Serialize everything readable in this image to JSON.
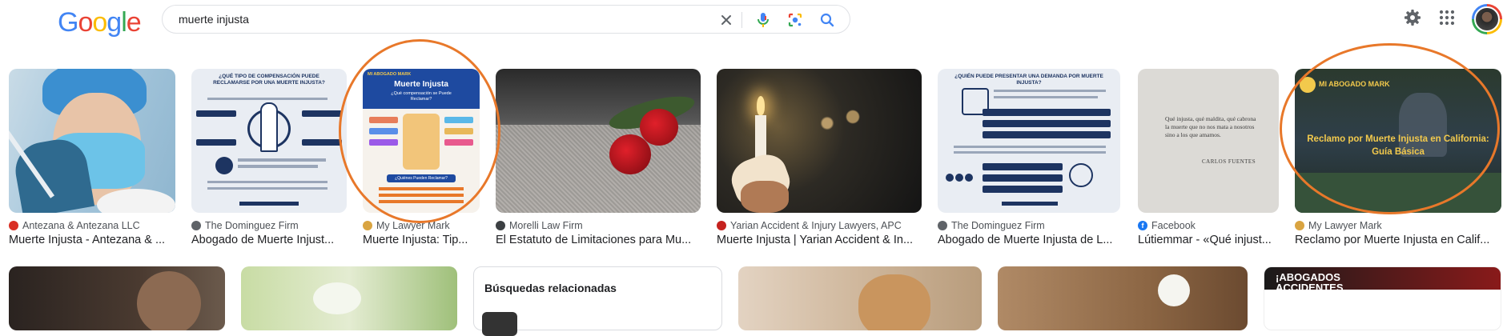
{
  "logo": {
    "letters": [
      {
        "ch": "G",
        "color": "#4285f4"
      },
      {
        "ch": "o",
        "color": "#ea4335"
      },
      {
        "ch": "o",
        "color": "#fbbc05"
      },
      {
        "ch": "g",
        "color": "#4285f4"
      },
      {
        "ch": "l",
        "color": "#34a853"
      },
      {
        "ch": "e",
        "color": "#ea4335"
      }
    ]
  },
  "search": {
    "query": "muerte injusta"
  },
  "icons": {
    "clear": "close-icon",
    "voice": "microphone-icon",
    "lens": "lens-icon",
    "search": "search-icon",
    "settings": "gear-icon",
    "apps": "apps-grid-icon"
  },
  "results": [
    {
      "source": "Antezana & Antezana LLC",
      "title": "Muerte Injusta - Antezana & ...",
      "fav_color": "#d93025"
    },
    {
      "source": "The Dominguez Firm",
      "title": "Abogado de Muerte Injust...",
      "fav_color": "#5f6368"
    },
    {
      "source": "My Lawyer Mark",
      "title": "Muerte Injusta: Tip...",
      "fav_color": "#d9a441"
    },
    {
      "source": "Morelli Law Firm",
      "title": "El Estatuto de Limitaciones para Mu...",
      "fav_color": "#3c4043"
    },
    {
      "source": "Yarian Accident & Injury Lawyers, APC",
      "title": "Muerte Injusta | Yarian Accident & In...",
      "fav_color": "#c5221f"
    },
    {
      "source": "The Dominguez Firm",
      "title": "Abogado de Muerte Injusta de L...",
      "fav_color": "#5f6368"
    },
    {
      "source": "Facebook",
      "title": "Lútiemmar - «Qué injust...",
      "fav_color": "#1877f2"
    },
    {
      "source": "My Lawyer Mark",
      "title": "Reclamo por Muerte Injusta en Calif...",
      "fav_color": "#d9a441"
    }
  ],
  "image_text": {
    "dominguez_q1": "¿QUÉ TIPO DE COMPENSACIÓN PUEDE RECLAMARSE POR UNA MUERTE INJUSTA?",
    "mark_brand": "MI ABOGADO MARK",
    "mark_title": "Muerte Injusta",
    "mark_sub": "¿Qué compensación se Puede Reclamar?",
    "mark_q": "¿Quiénes Pueden Reclamar?",
    "dominguez_q2": "¿QUIÉN PUEDE PRESENTAR UNA DEMANDA POR MUERTE INJUSTA?",
    "book_quote": "Qué injusta, qué maldita, qué cabrona la muerte que no nos mata a nosotros sino a los que amamos.",
    "book_author": "CARLOS FUENTES",
    "reclamo_brand": "MI ABOGADO MARK",
    "reclamo_line1": "Reclamo por Muerte Injusta en California:",
    "reclamo_line2": "Guía Básica",
    "abogados_line1": "¡ABOGADOS",
    "abogados_line2": "ACCIDENTES"
  },
  "related": {
    "heading": "Búsquedas relacionadas"
  },
  "annotation_color": "#e8782a"
}
